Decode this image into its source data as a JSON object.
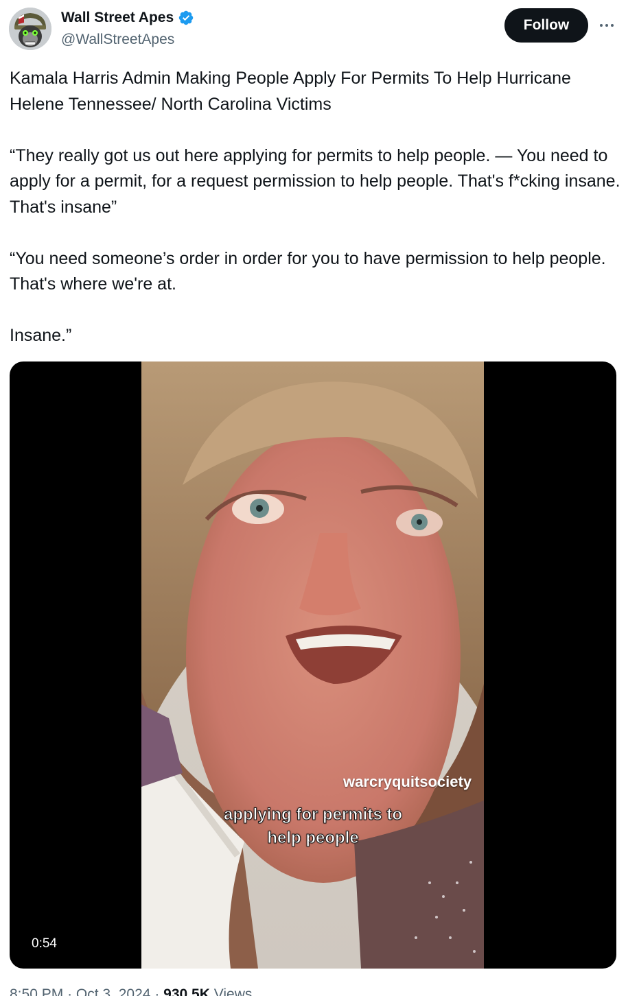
{
  "author": {
    "display_name": "Wall Street Apes",
    "handle": "@WallStreetApes",
    "verified": true,
    "verified_color": "#1d9bf0"
  },
  "follow_button": {
    "label": "Follow"
  },
  "more_button": {
    "icon": "more-horizontal-icon"
  },
  "tweet": {
    "paragraphs": [
      "Kamala Harris Admin Making People Apply For Permits To Help Hurricane Helene Tennessee/ North Carolina Victims",
      "“They really got us out here applying for permits to help people. — You need to apply for a permit, for a request permission to help people. That's f*cking insane. That's insane”",
      "“You need someone’s order in order for you to have permission to help people. That's where we're at.",
      "Insane.”"
    ]
  },
  "media": {
    "watermark": "warcryquitsociety",
    "caption": "applying for permits to help people",
    "duration": "0:54"
  },
  "meta": {
    "time": "8:50 PM",
    "separator": "·",
    "date": "Oct 3, 2024",
    "views_count": "930.5K",
    "views_label": "Views"
  },
  "colors": {
    "text": "#0f1419",
    "secondary_text": "#536471",
    "follow_bg": "#0f1419",
    "media_bg": "#000000"
  }
}
